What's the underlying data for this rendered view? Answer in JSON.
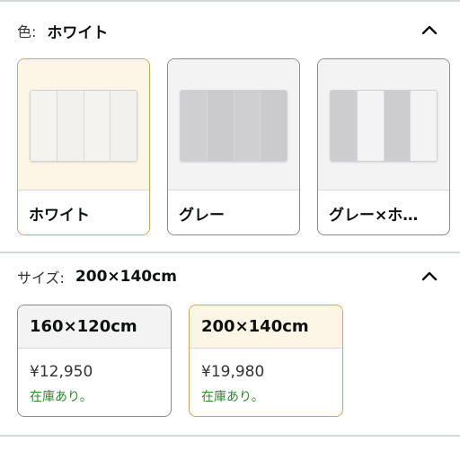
{
  "color_section": {
    "label": "色:",
    "selected_value": "ホワイト",
    "options": [
      {
        "label": "ホワイト",
        "selected": true,
        "panels": [
          "#f4f3ef",
          "#f2f1ed",
          "#f4f3ef",
          "#f2f1ed"
        ]
      },
      {
        "label": "グレー",
        "selected": false,
        "panels": [
          "#cfcfd1",
          "#cbcbcd",
          "#cfcfd1",
          "#cbcbcd"
        ]
      },
      {
        "label": "グレー×ホ…",
        "selected": false,
        "panels": [
          "#cdcdcf",
          "#f3f3f3",
          "#cdcdcf",
          "#f3f3f3"
        ]
      }
    ]
  },
  "size_section": {
    "label": "サイズ:",
    "selected_value": "200×140cm",
    "options": [
      {
        "label": "160×120cm",
        "price": "¥12,950",
        "stock": "在庫あり。",
        "selected": false
      },
      {
        "label": "200×140cm",
        "price": "¥19,980",
        "stock": "在庫あり。",
        "selected": true
      }
    ]
  },
  "icons": {
    "collapse": "chevron-up-icon"
  },
  "colors": {
    "selected_border": "#c8a85a",
    "selected_bg": "#fdf6e7",
    "in_stock": "#2e8b2e",
    "divider": "#d5d9d9"
  }
}
